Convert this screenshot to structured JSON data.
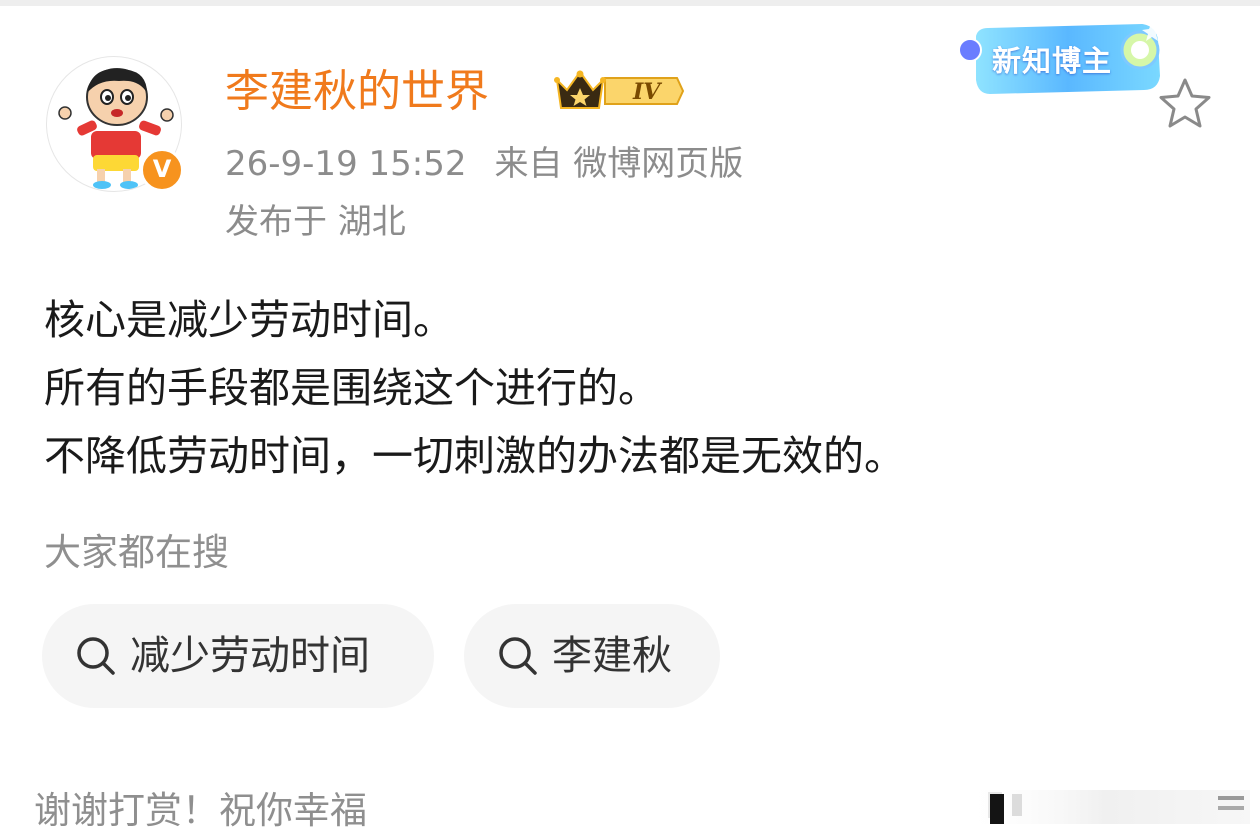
{
  "header": {
    "username": "李建秋的世界",
    "level_badge": "IV",
    "timestamp": "26-9-19 15:52",
    "source": "来自 微博网页版",
    "location": "发布于 湖北",
    "new_blogger_badge": "新知博主"
  },
  "post": {
    "lines": [
      "核心是减少劳动时间。",
      "所有的手段都是围绕这个进行的。",
      "不降低劳动时间，一切刺激的办法都是无效的。"
    ]
  },
  "search": {
    "heading": "大家都在搜",
    "chips": [
      {
        "label": "减少劳动时间",
        "icon": "search-icon"
      },
      {
        "label": "李建秋",
        "icon": "search-icon"
      }
    ]
  },
  "footer": {
    "thanks": "谢谢打赏！祝你幸福"
  },
  "colors": {
    "username": "#f07a1c",
    "meta": "#8c8c8c",
    "body_text": "#1a1a1a",
    "chip_bg": "#f5f5f5",
    "verified": "#f7931e",
    "level_badge": "#f5a623"
  }
}
